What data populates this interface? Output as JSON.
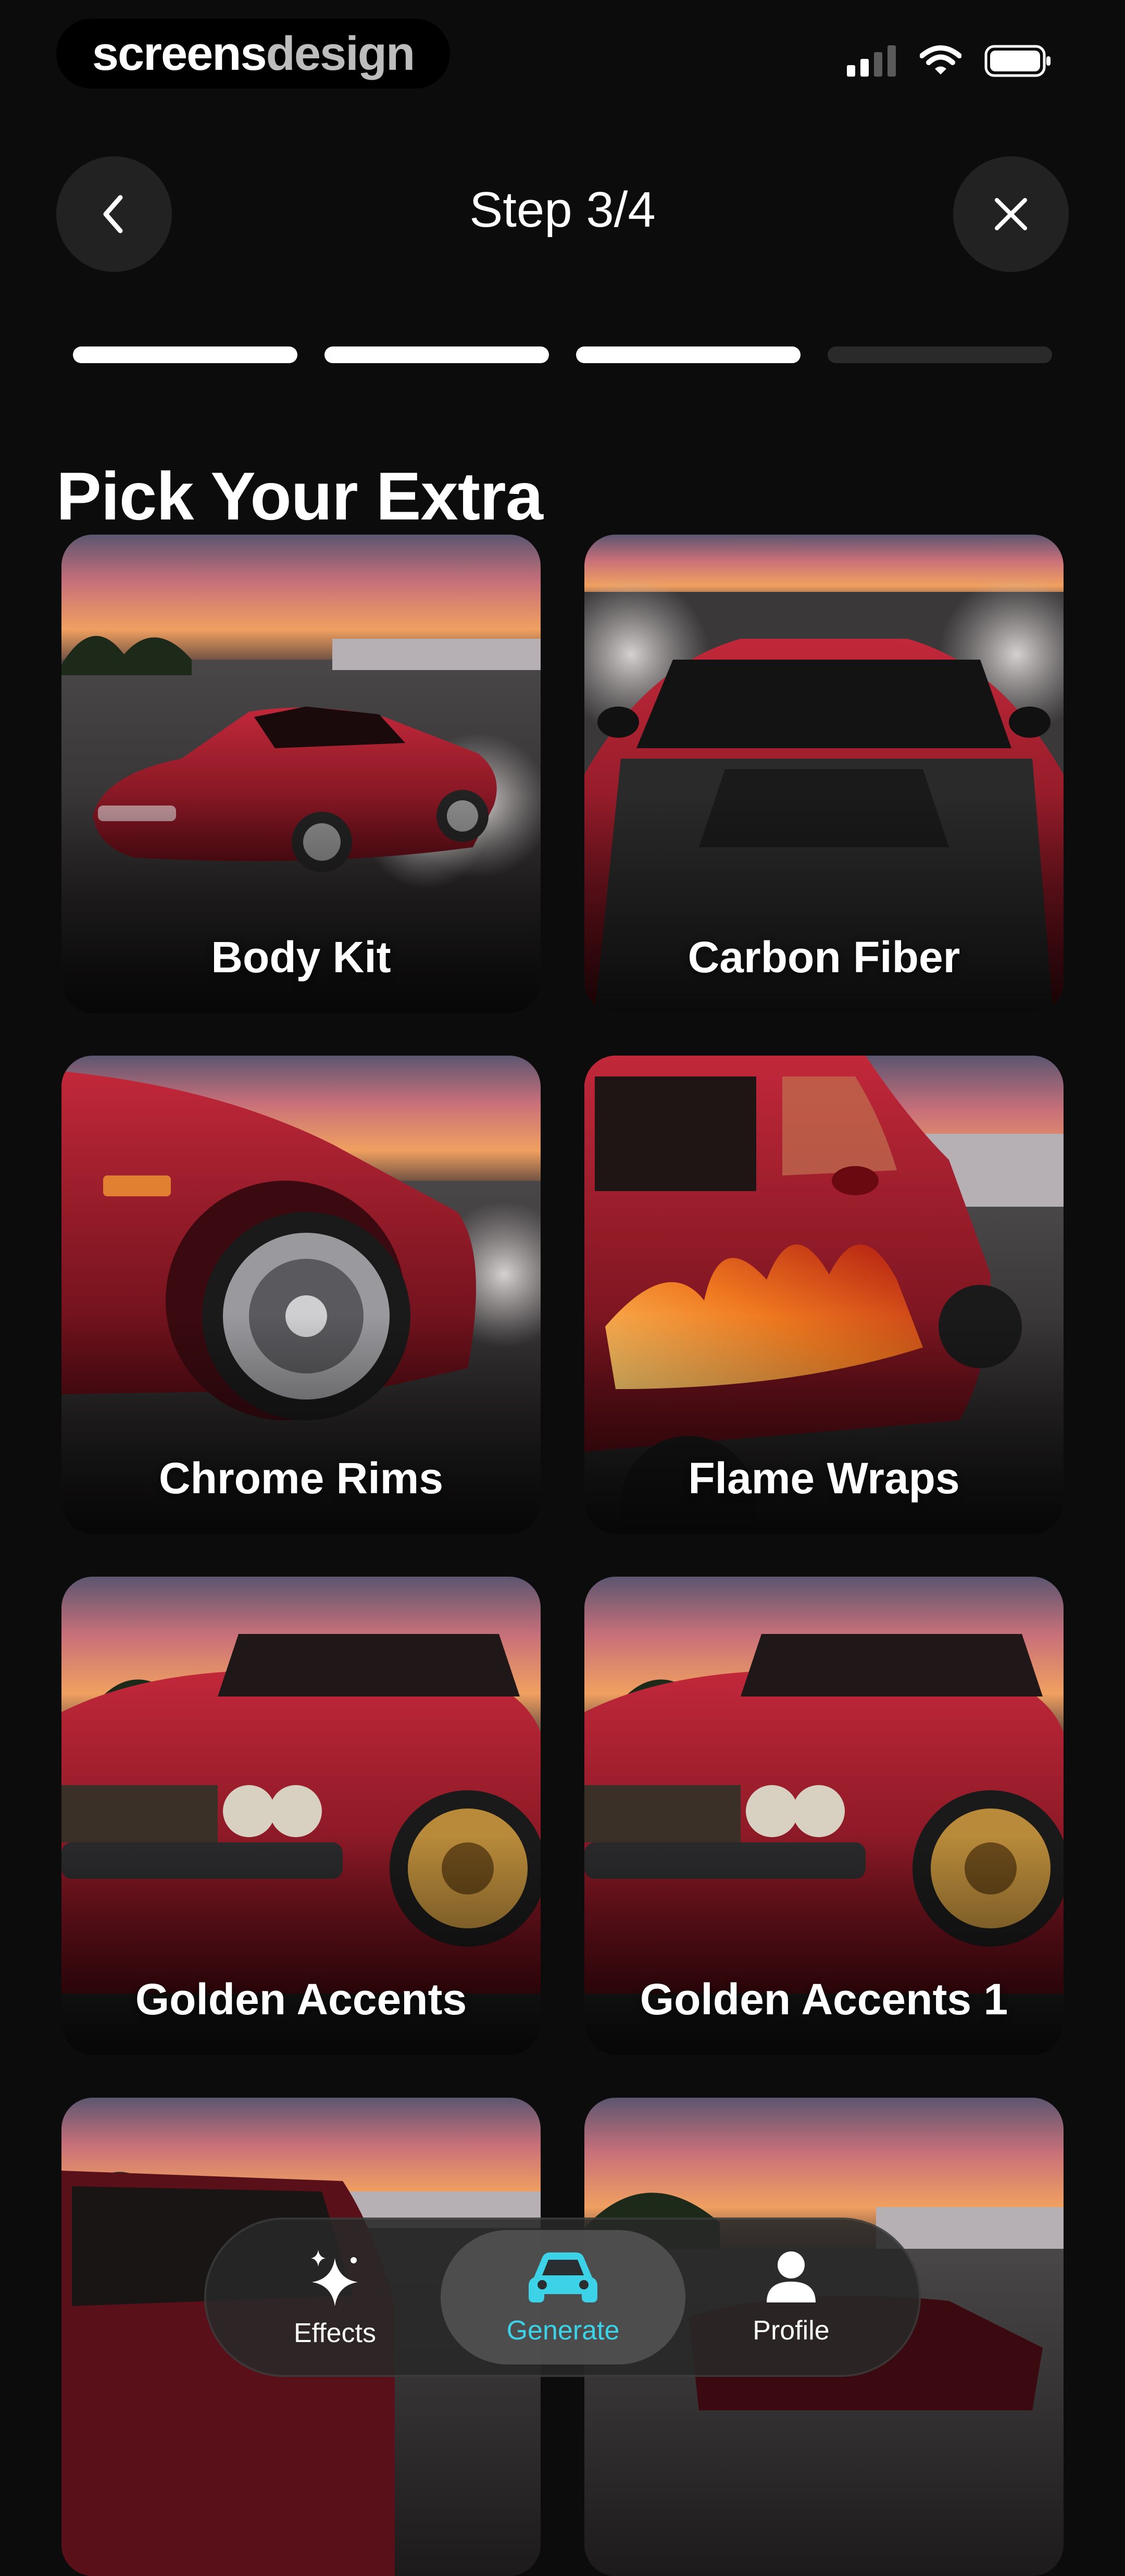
{
  "brand": {
    "part1": "screens",
    "part2": "design"
  },
  "header": {
    "step_title": "Step 3/4"
  },
  "progress": {
    "completed": 3,
    "total": 4
  },
  "page": {
    "heading": "Pick Your Extra"
  },
  "options": [
    {
      "label": "Body Kit"
    },
    {
      "label": "Carbon Fiber"
    },
    {
      "label": "Chrome Rims"
    },
    {
      "label": "Flame Wraps"
    },
    {
      "label": "Golden Accents"
    },
    {
      "label": "Golden Accents 1"
    }
  ],
  "tabs": [
    {
      "label": "Effects",
      "icon": "sparkles-icon",
      "active": false
    },
    {
      "label": "Generate",
      "icon": "car-icon",
      "active": true
    },
    {
      "label": "Profile",
      "icon": "person-icon",
      "active": false
    }
  ],
  "colors": {
    "background": "#0c0c0c",
    "accent": "#3cd2e8",
    "car_red": "#8c1420",
    "sky_orange": "#e8844a"
  }
}
